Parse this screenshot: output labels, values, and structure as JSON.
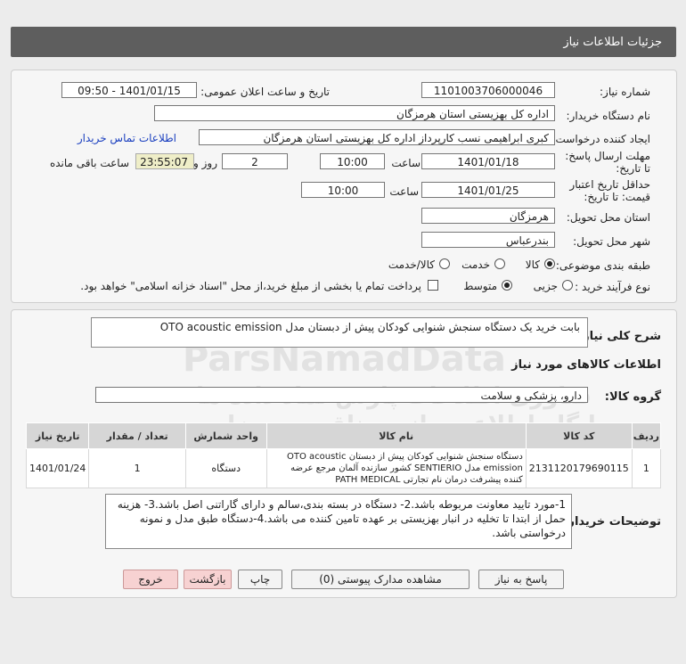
{
  "header": {
    "title": "جزئیات اطلاعات نیاز"
  },
  "form": {
    "need_number_label": "شماره نیاز:",
    "need_number": "1101003706000046",
    "announce_label": "تاریخ و ساعت اعلان عمومی:",
    "announce_value": "1401/01/15 - 09:50",
    "buyer_org_label": "نام دستگاه خریدار:",
    "buyer_org": "اداره کل بهزیستی استان هرمزگان",
    "requester_label": "ایجاد کننده درخواست:",
    "requester": "کبری  ابراهیمی نسب کارپرداز اداره کل بهزیستی استان هرمزگان",
    "contact_link": "اطلاعات تماس خریدار",
    "reply_deadline_label": "مهلت ارسال پاسخ: تا تاریخ:",
    "reply_date": "1401/01/18",
    "time_label": "ساعت",
    "reply_time": "10:00",
    "days": "2",
    "days_label": "روز و",
    "remaining_time": "23:55:07",
    "remaining_label": "ساعت باقی مانده",
    "validity_label": "حداقل تاریخ اعتبار قیمت: تا تاریخ:",
    "validity_date": "1401/01/25",
    "validity_time": "10:00",
    "province_label": "استان محل تحویل:",
    "province": "هرمزگان",
    "city_label": "شهر محل تحویل:",
    "city": "بندرعباس",
    "category_label": "طبقه بندی موضوعی:",
    "category_options": [
      "کالا",
      "خدمت",
      "کالا/خدمت"
    ],
    "process_label": "نوع فرآیند خرید :",
    "process_options": [
      "جزیی",
      "متوسط"
    ],
    "payment_note": "پرداخت تمام یا بخشی از مبلغ خرید،از محل \"اسناد خزانه اسلامی\" خواهد بود."
  },
  "summary": {
    "label": "شرح کلی نیاز:",
    "text": "بابت خرید  یک دستگاه سنجش شنوایی کودکان پیش از دبستان مدل  OTO acoustic emission"
  },
  "goods": {
    "section_title": "اطلاعات کالاهای مورد نیاز",
    "group_label": "گروه کالا:",
    "group_value": "دارو، پزشکی و سلامت",
    "columns": [
      "ردیف",
      "کد کالا",
      "نام کالا",
      "واحد شمارش",
      "تعداد / مقدار",
      "تاریخ نیاز"
    ],
    "rows": [
      {
        "row": "1",
        "code": "2131120179690115",
        "name": "دستگاه سنجش شنوایی کودکان پیش از دبستان OTO acoustic emission مدل SENTIERIO کشور سازنده آلمان مرجع عرضه کننده پیشرفت درمان نام تجارتی PATH MEDICAL",
        "unit": "دستگاه",
        "qty": "1",
        "date": "1401/01/24"
      }
    ]
  },
  "notes": {
    "label": "توضیحات خریدار:",
    "text": "1-مورد تایید معاونت مربوطه باشد.2- دستگاه در بسته بندی،سالم و دارای گاراتنی اصل باشد.3- هزینه حمل از ابتدا تا تخلیه در انبار بهزیستی بر عهده تامین کننده می باشد.4-دستگاه طبق مدل و نمونه درخواستی باشد."
  },
  "buttons": {
    "reply": "پاسخ به نیاز",
    "docs": "مشاهده مدارک پیوستی (0)",
    "print": "چاپ",
    "back": "بازگشت",
    "exit": "خروج"
  },
  "watermark": {
    "brand": "ParsNamadData",
    "line1": "پایگاه اطلاع رسانی مناقصه و مزایده",
    "line2": "فناوری اطلاعات پارس نماد داده ها"
  },
  "colors": {
    "header_bg": "#5e5e5e",
    "link": "#1a3fbf",
    "remaining_bg": "#efeec8",
    "danger_btn": "#f7d2d2"
  }
}
